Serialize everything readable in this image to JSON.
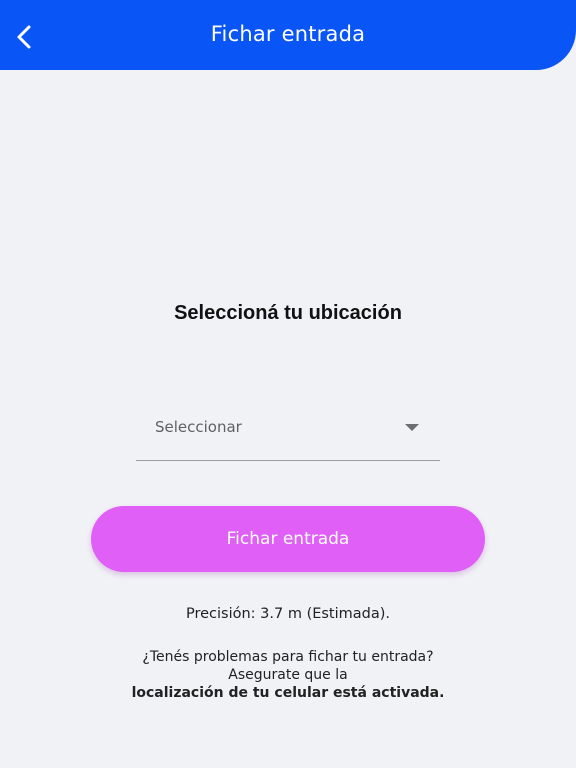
{
  "header": {
    "title": "Fichar entrada",
    "background_color": "#0a55f5"
  },
  "location": {
    "title": "Seleccioná tu ubicación",
    "select_value": "Seleccionar"
  },
  "submit": {
    "label": "Fichar entrada",
    "color": "#e05ff6"
  },
  "precision": {
    "text": "Precisión: 3.7 m (Estimada)."
  },
  "help": {
    "line1": "¿Tenés problemas para fichar tu entrada?",
    "line2": "Asegurate que la",
    "line3": "localización de tu celular está activada."
  },
  "icons": {
    "back": "chevron-left-icon",
    "dropdown": "caret-down-icon"
  }
}
